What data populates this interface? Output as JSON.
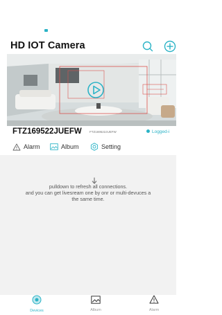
{
  "header": {
    "title": "HD IOT Camera",
    "icons": [
      "search-icon",
      "plus-circle-icon"
    ]
  },
  "device": {
    "name": "FTZ169522JUEFW",
    "subname": "FTZ169522JUEFW",
    "status": "Logged-i"
  },
  "actions": {
    "alarm_label": "Alarm",
    "album_label": "Album",
    "setting_label": "Setting"
  },
  "hint": {
    "line1": "pulldown to refresh all connections.",
    "line2": "and you can get livesream one by onr or multi-devuces a",
    "line3": "the same time."
  },
  "tabs": {
    "devices_label": "Devices",
    "album_label": "Album",
    "alarm_label": "Alarm"
  },
  "colors": {
    "accent": "#2bb3c6"
  }
}
